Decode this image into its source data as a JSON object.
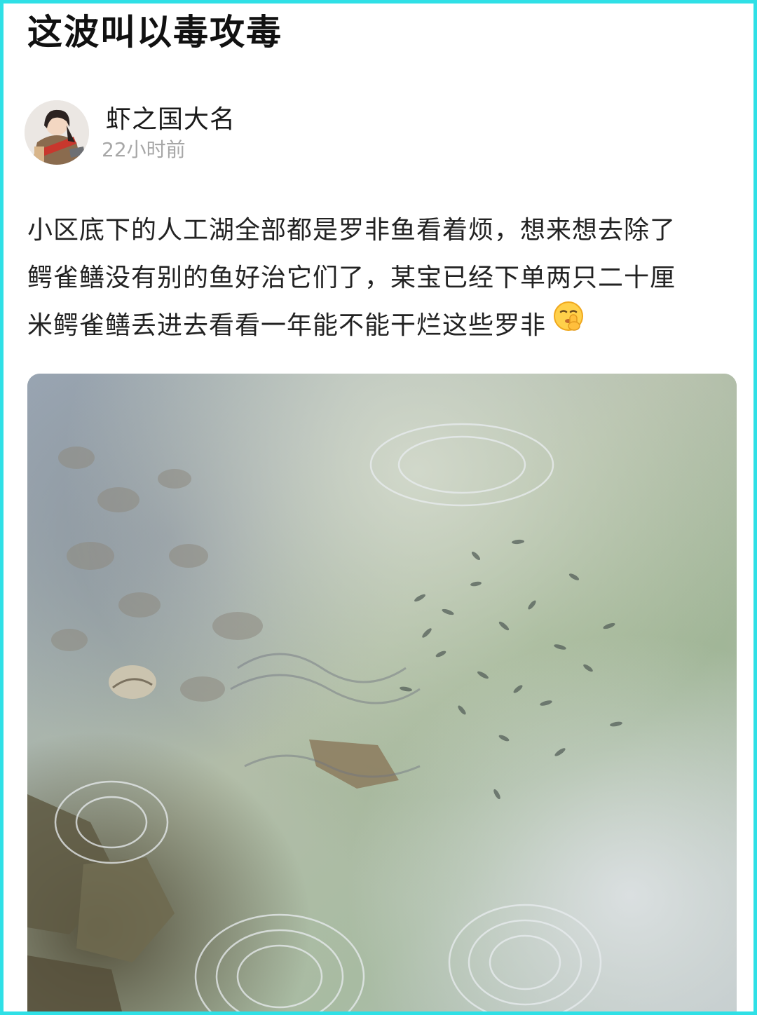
{
  "post": {
    "title": "这波叫以毒攻毒",
    "author": {
      "name": "虾之国大名",
      "time": "22小时前",
      "avatar_icon": "anime-character-avatar"
    },
    "body_lines": [
      "小区底下的人工湖全部都是罗非鱼看着烦，想来想去除了",
      "鳄雀鳝没有别的鱼好治它们了，某宝已经下单两只二十厘",
      "米鳄雀鳝丢进去看看一年能不能干烂这些罗非"
    ],
    "emoji": "shushing-face-emoji",
    "image": {
      "subject": "pond-water-with-fish-photo"
    }
  },
  "colors": {
    "frame_border": "#2fe0e6",
    "title": "#111111",
    "time": "#a7a7a7"
  }
}
